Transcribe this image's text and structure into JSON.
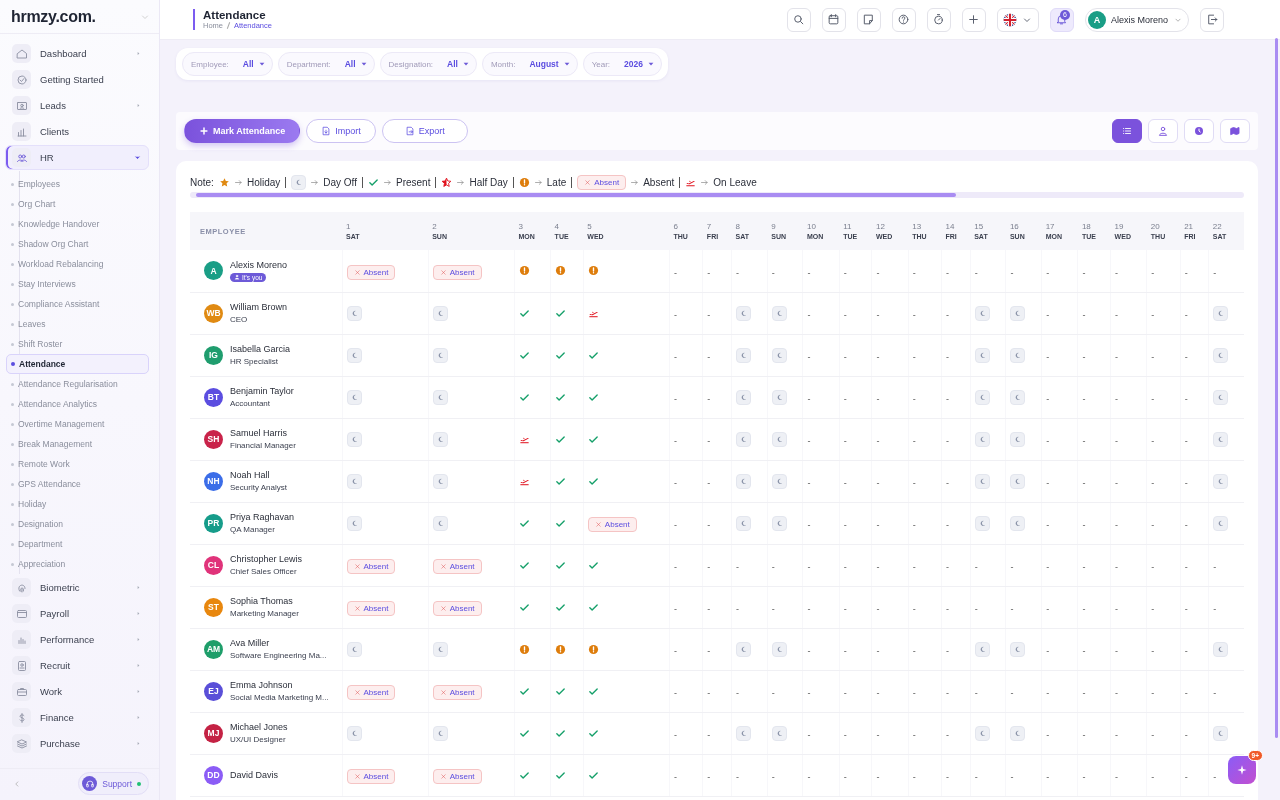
{
  "sidebar": {
    "logo": "hrmzy.com.",
    "items": [
      {
        "label": "Dashboard",
        "arrow": true,
        "selected": false
      },
      {
        "label": "Getting Started",
        "arrow": false,
        "selected": false
      },
      {
        "label": "Leads",
        "arrow": true,
        "selected": false
      },
      {
        "label": "Clients",
        "arrow": false,
        "selected": false
      },
      {
        "label": "HR",
        "arrow": true,
        "selected": true,
        "expanded": true,
        "children": [
          {
            "label": "Employees",
            "selected": false
          },
          {
            "label": "Org Chart",
            "selected": false
          },
          {
            "label": "Knowledge Handover",
            "selected": false
          },
          {
            "label": "Shadow Org Chart",
            "selected": false
          },
          {
            "label": "Workload Rebalancing",
            "selected": false
          },
          {
            "label": "Stay Interviews",
            "selected": false
          },
          {
            "label": "Compliance Assistant",
            "selected": false
          },
          {
            "label": "Leaves",
            "selected": false
          },
          {
            "label": "Shift Roster",
            "selected": false
          },
          {
            "label": "Attendance",
            "selected": true
          },
          {
            "label": "Attendance Regularisation",
            "selected": false
          },
          {
            "label": "Attendance Analytics",
            "selected": false
          },
          {
            "label": "Overtime Management",
            "selected": false
          },
          {
            "label": "Break Management",
            "selected": false
          },
          {
            "label": "Remote Work",
            "selected": false
          },
          {
            "label": "GPS Attendance",
            "selected": false
          },
          {
            "label": "Holiday",
            "selected": false
          },
          {
            "label": "Designation",
            "selected": false
          },
          {
            "label": "Department",
            "selected": false
          },
          {
            "label": "Appreciation",
            "selected": false
          }
        ]
      },
      {
        "label": "Biometric",
        "arrow": true,
        "selected": false
      },
      {
        "label": "Payroll",
        "arrow": true,
        "selected": false
      },
      {
        "label": "Performance",
        "arrow": true,
        "selected": false
      },
      {
        "label": "Recruit",
        "arrow": true,
        "selected": false
      },
      {
        "label": "Work",
        "arrow": true,
        "selected": false
      },
      {
        "label": "Finance",
        "arrow": true,
        "selected": false
      },
      {
        "label": "Purchase",
        "arrow": true,
        "selected": false
      }
    ],
    "support": "Support"
  },
  "header": {
    "title": "Attendance",
    "breadcrumb": [
      {
        "label": "Home",
        "selected": false
      },
      {
        "label": "Attendance",
        "selected": true
      }
    ],
    "notifications": "6",
    "user": {
      "initial": "A",
      "name": "Alexis Moreno"
    }
  },
  "filters": [
    {
      "label": "Employee:",
      "value": "All"
    },
    {
      "label": "Department:",
      "value": "All"
    },
    {
      "label": "Designation:",
      "value": "All"
    },
    {
      "label": "Month:",
      "value": "August"
    },
    {
      "label": "Year:",
      "value": "2026"
    }
  ],
  "actions": [
    {
      "kind": "mark",
      "label": "Mark Attendance"
    },
    {
      "kind": "import",
      "label": "Import"
    },
    {
      "kind": "export",
      "label": "Export"
    }
  ],
  "views": [
    {
      "kind": "list",
      "selected": true
    },
    {
      "kind": "person",
      "selected": false
    },
    {
      "kind": "clock",
      "selected": false
    },
    {
      "kind": "map",
      "selected": false
    }
  ],
  "legend": {
    "title": "Note:",
    "items": [
      {
        "kind": "holiday",
        "label": "Holiday"
      },
      {
        "kind": "dayoff",
        "label": "Day Off"
      },
      {
        "kind": "present",
        "label": "Present"
      },
      {
        "kind": "halfday",
        "label": "Half Day"
      },
      {
        "kind": "late",
        "label": "Late"
      },
      {
        "kind": "absent",
        "badge": "Absent",
        "label": "Absent"
      },
      {
        "kind": "leave",
        "label": "On Leave"
      }
    ]
  },
  "table": {
    "first_column": "EMPLOYEE",
    "days": [
      {
        "day": "1",
        "weekday": "SAT"
      },
      {
        "day": "2",
        "weekday": "SUN"
      },
      {
        "day": "3",
        "weekday": "MON"
      },
      {
        "day": "4",
        "weekday": "TUE"
      },
      {
        "day": "5",
        "weekday": "WED"
      },
      {
        "day": "6",
        "weekday": "THU"
      },
      {
        "day": "7",
        "weekday": "FRI"
      },
      {
        "day": "8",
        "weekday": "SAT"
      },
      {
        "day": "9",
        "weekday": "SUN"
      },
      {
        "day": "10",
        "weekday": "MON"
      },
      {
        "day": "11",
        "weekday": "TUE"
      },
      {
        "day": "12",
        "weekday": "WED"
      },
      {
        "day": "13",
        "weekday": "THU"
      },
      {
        "day": "14",
        "weekday": "FRI"
      },
      {
        "day": "15",
        "weekday": "SAT"
      },
      {
        "day": "16",
        "weekday": "SUN"
      },
      {
        "day": "17",
        "weekday": "MON"
      },
      {
        "day": "18",
        "weekday": "TUE"
      },
      {
        "day": "19",
        "weekday": "WED"
      },
      {
        "day": "20",
        "weekday": "THU"
      },
      {
        "day": "21",
        "weekday": "FRI"
      },
      {
        "day": "22",
        "weekday": "SAT"
      }
    ],
    "rows": [
      {
        "initials": "A",
        "color": "#1a9e86",
        "name": "Alexis Moreno",
        "you": "It's you",
        "cells": [
          {
            "kind": "absent",
            "text": "Absent"
          },
          {
            "kind": "absent",
            "text": "Absent"
          },
          {
            "kind": "late"
          },
          {
            "kind": "late"
          },
          {
            "kind": "late"
          },
          {
            "kind": "none",
            "text": "-"
          },
          {
            "kind": "none",
            "text": "-"
          },
          {
            "kind": "none",
            "text": "-"
          },
          {
            "kind": "none",
            "text": "-"
          },
          {
            "kind": "none",
            "text": "-"
          },
          {
            "kind": "none",
            "text": "-"
          },
          {
            "kind": "none",
            "text": "-"
          },
          {
            "kind": "none",
            "text": "-"
          },
          {
            "kind": "none",
            "text": "-"
          },
          {
            "kind": "none",
            "text": "-"
          },
          {
            "kind": "none",
            "text": "-"
          },
          {
            "kind": "none",
            "text": "-"
          },
          {
            "kind": "none",
            "text": "-"
          },
          {
            "kind": "none",
            "text": "-"
          },
          {
            "kind": "none",
            "text": "-"
          },
          {
            "kind": "none",
            "text": "-"
          },
          {
            "kind": "none",
            "text": "-"
          }
        ]
      },
      {
        "initials": "WB",
        "color": "#e08a12",
        "name": "William Brown",
        "role": "CEO",
        "cells": [
          {
            "kind": "dayoff"
          },
          {
            "kind": "dayoff"
          },
          {
            "kind": "present"
          },
          {
            "kind": "present"
          },
          {
            "kind": "leave"
          },
          {
            "kind": "none",
            "text": "-"
          },
          {
            "kind": "none",
            "text": "-"
          },
          {
            "kind": "dayoff"
          },
          {
            "kind": "dayoff"
          },
          {
            "kind": "none",
            "text": "-"
          },
          {
            "kind": "none",
            "text": "-"
          },
          {
            "kind": "none",
            "text": "-"
          },
          {
            "kind": "none",
            "text": "-"
          },
          {
            "kind": "none",
            "text": "-"
          },
          {
            "kind": "dayoff"
          },
          {
            "kind": "dayoff"
          },
          {
            "kind": "none",
            "text": "-"
          },
          {
            "kind": "none",
            "text": "-"
          },
          {
            "kind": "none",
            "text": "-"
          },
          {
            "kind": "none",
            "text": "-"
          },
          {
            "kind": "none",
            "text": "-"
          },
          {
            "kind": "dayoff"
          }
        ]
      },
      {
        "initials": "IG",
        "color": "#1f9d6e",
        "name": "Isabella Garcia",
        "role": "HR Specialist",
        "cells": [
          {
            "kind": "dayoff"
          },
          {
            "kind": "dayoff"
          },
          {
            "kind": "present"
          },
          {
            "kind": "present"
          },
          {
            "kind": "present"
          },
          {
            "kind": "none",
            "text": "-"
          },
          {
            "kind": "none",
            "text": "-"
          },
          {
            "kind": "dayoff"
          },
          {
            "kind": "dayoff"
          },
          {
            "kind": "none",
            "text": "-"
          },
          {
            "kind": "none",
            "text": "-"
          },
          {
            "kind": "none",
            "text": "-"
          },
          {
            "kind": "none",
            "text": "-"
          },
          {
            "kind": "none",
            "text": "-"
          },
          {
            "kind": "dayoff"
          },
          {
            "kind": "dayoff"
          },
          {
            "kind": "none",
            "text": "-"
          },
          {
            "kind": "none",
            "text": "-"
          },
          {
            "kind": "none",
            "text": "-"
          },
          {
            "kind": "none",
            "text": "-"
          },
          {
            "kind": "none",
            "text": "-"
          },
          {
            "kind": "dayoff"
          }
        ]
      },
      {
        "initials": "BT",
        "color": "#5b4de0",
        "name": "Benjamin Taylor",
        "role": "Accountant",
        "cells": [
          {
            "kind": "dayoff"
          },
          {
            "kind": "dayoff"
          },
          {
            "kind": "present"
          },
          {
            "kind": "present"
          },
          {
            "kind": "present"
          },
          {
            "kind": "none",
            "text": "-"
          },
          {
            "kind": "none",
            "text": "-"
          },
          {
            "kind": "dayoff"
          },
          {
            "kind": "dayoff"
          },
          {
            "kind": "none",
            "text": "-"
          },
          {
            "kind": "none",
            "text": "-"
          },
          {
            "kind": "none",
            "text": "-"
          },
          {
            "kind": "none",
            "text": "-"
          },
          {
            "kind": "none",
            "text": "-"
          },
          {
            "kind": "dayoff"
          },
          {
            "kind": "dayoff"
          },
          {
            "kind": "none",
            "text": "-"
          },
          {
            "kind": "none",
            "text": "-"
          },
          {
            "kind": "none",
            "text": "-"
          },
          {
            "kind": "none",
            "text": "-"
          },
          {
            "kind": "none",
            "text": "-"
          },
          {
            "kind": "dayoff"
          }
        ]
      },
      {
        "initials": "SH",
        "color": "#c9234a",
        "name": "Samuel Harris",
        "role": "Financial Manager",
        "cells": [
          {
            "kind": "dayoff"
          },
          {
            "kind": "dayoff"
          },
          {
            "kind": "leave"
          },
          {
            "kind": "present"
          },
          {
            "kind": "present"
          },
          {
            "kind": "none",
            "text": "-"
          },
          {
            "kind": "none",
            "text": "-"
          },
          {
            "kind": "dayoff"
          },
          {
            "kind": "dayoff"
          },
          {
            "kind": "none",
            "text": "-"
          },
          {
            "kind": "none",
            "text": "-"
          },
          {
            "kind": "none",
            "text": "-"
          },
          {
            "kind": "none",
            "text": "-"
          },
          {
            "kind": "none",
            "text": "-"
          },
          {
            "kind": "dayoff"
          },
          {
            "kind": "dayoff"
          },
          {
            "kind": "none",
            "text": "-"
          },
          {
            "kind": "none",
            "text": "-"
          },
          {
            "kind": "none",
            "text": "-"
          },
          {
            "kind": "none",
            "text": "-"
          },
          {
            "kind": "none",
            "text": "-"
          },
          {
            "kind": "dayoff"
          }
        ]
      },
      {
        "initials": "NH",
        "color": "#3b6de8",
        "name": "Noah Hall",
        "role": "Security Analyst",
        "cells": [
          {
            "kind": "dayoff"
          },
          {
            "kind": "dayoff"
          },
          {
            "kind": "leave"
          },
          {
            "kind": "present"
          },
          {
            "kind": "present"
          },
          {
            "kind": "none",
            "text": "-"
          },
          {
            "kind": "none",
            "text": "-"
          },
          {
            "kind": "dayoff"
          },
          {
            "kind": "dayoff"
          },
          {
            "kind": "none",
            "text": "-"
          },
          {
            "kind": "none",
            "text": "-"
          },
          {
            "kind": "none",
            "text": "-"
          },
          {
            "kind": "none",
            "text": "-"
          },
          {
            "kind": "none",
            "text": "-"
          },
          {
            "kind": "dayoff"
          },
          {
            "kind": "dayoff"
          },
          {
            "kind": "none",
            "text": "-"
          },
          {
            "kind": "none",
            "text": "-"
          },
          {
            "kind": "none",
            "text": "-"
          },
          {
            "kind": "none",
            "text": "-"
          },
          {
            "kind": "none",
            "text": "-"
          },
          {
            "kind": "dayoff"
          }
        ]
      },
      {
        "initials": "PR",
        "color": "#169c8a",
        "name": "Priya Raghavan",
        "role": "QA Manager",
        "cells": [
          {
            "kind": "dayoff"
          },
          {
            "kind": "dayoff"
          },
          {
            "kind": "present"
          },
          {
            "kind": "present"
          },
          {
            "kind": "absent",
            "text": "Absent"
          },
          {
            "kind": "none",
            "text": "-"
          },
          {
            "kind": "none",
            "text": "-"
          },
          {
            "kind": "dayoff"
          },
          {
            "kind": "dayoff"
          },
          {
            "kind": "none",
            "text": "-"
          },
          {
            "kind": "none",
            "text": "-"
          },
          {
            "kind": "none",
            "text": "-"
          },
          {
            "kind": "none",
            "text": "-"
          },
          {
            "kind": "none",
            "text": "-"
          },
          {
            "kind": "dayoff"
          },
          {
            "kind": "dayoff"
          },
          {
            "kind": "none",
            "text": "-"
          },
          {
            "kind": "none",
            "text": "-"
          },
          {
            "kind": "none",
            "text": "-"
          },
          {
            "kind": "none",
            "text": "-"
          },
          {
            "kind": "none",
            "text": "-"
          },
          {
            "kind": "dayoff"
          }
        ]
      },
      {
        "initials": "CL",
        "color": "#e0337a",
        "name": "Christopher Lewis",
        "role": "Chief Sales Officer",
        "cells": [
          {
            "kind": "absent",
            "text": "Absent"
          },
          {
            "kind": "absent",
            "text": "Absent"
          },
          {
            "kind": "present"
          },
          {
            "kind": "present"
          },
          {
            "kind": "present"
          },
          {
            "kind": "none",
            "text": "-"
          },
          {
            "kind": "none",
            "text": "-"
          },
          {
            "kind": "none",
            "text": "-"
          },
          {
            "kind": "none",
            "text": "-"
          },
          {
            "kind": "none",
            "text": "-"
          },
          {
            "kind": "none",
            "text": "-"
          },
          {
            "kind": "none",
            "text": "-"
          },
          {
            "kind": "none",
            "text": "-"
          },
          {
            "kind": "none",
            "text": "-"
          },
          {
            "kind": "none",
            "text": "-"
          },
          {
            "kind": "none",
            "text": "-"
          },
          {
            "kind": "none",
            "text": "-"
          },
          {
            "kind": "none",
            "text": "-"
          },
          {
            "kind": "none",
            "text": "-"
          },
          {
            "kind": "none",
            "text": "-"
          },
          {
            "kind": "none",
            "text": "-"
          },
          {
            "kind": "none",
            "text": "-"
          }
        ]
      },
      {
        "initials": "ST",
        "color": "#e8870e",
        "name": "Sophia Thomas",
        "role": "Marketing Manager",
        "cells": [
          {
            "kind": "absent",
            "text": "Absent"
          },
          {
            "kind": "absent",
            "text": "Absent"
          },
          {
            "kind": "present"
          },
          {
            "kind": "present"
          },
          {
            "kind": "present"
          },
          {
            "kind": "none",
            "text": "-"
          },
          {
            "kind": "none",
            "text": "-"
          },
          {
            "kind": "none",
            "text": "-"
          },
          {
            "kind": "none",
            "text": "-"
          },
          {
            "kind": "none",
            "text": "-"
          },
          {
            "kind": "none",
            "text": "-"
          },
          {
            "kind": "none",
            "text": "-"
          },
          {
            "kind": "none",
            "text": "-"
          },
          {
            "kind": "none",
            "text": "-"
          },
          {
            "kind": "none",
            "text": "-"
          },
          {
            "kind": "none",
            "text": "-"
          },
          {
            "kind": "none",
            "text": "-"
          },
          {
            "kind": "none",
            "text": "-"
          },
          {
            "kind": "none",
            "text": "-"
          },
          {
            "kind": "none",
            "text": "-"
          },
          {
            "kind": "none",
            "text": "-"
          },
          {
            "kind": "none",
            "text": "-"
          }
        ]
      },
      {
        "initials": "AM",
        "color": "#1e9e6a",
        "name": "Ava Miller",
        "role": "Software Engineering Ma...",
        "cells": [
          {
            "kind": "dayoff"
          },
          {
            "kind": "dayoff"
          },
          {
            "kind": "late"
          },
          {
            "kind": "late"
          },
          {
            "kind": "late"
          },
          {
            "kind": "none",
            "text": "-"
          },
          {
            "kind": "none",
            "text": "-"
          },
          {
            "kind": "dayoff"
          },
          {
            "kind": "dayoff"
          },
          {
            "kind": "none",
            "text": "-"
          },
          {
            "kind": "none",
            "text": "-"
          },
          {
            "kind": "none",
            "text": "-"
          },
          {
            "kind": "none",
            "text": "-"
          },
          {
            "kind": "none",
            "text": "-"
          },
          {
            "kind": "dayoff"
          },
          {
            "kind": "dayoff"
          },
          {
            "kind": "none",
            "text": "-"
          },
          {
            "kind": "none",
            "text": "-"
          },
          {
            "kind": "none",
            "text": "-"
          },
          {
            "kind": "none",
            "text": "-"
          },
          {
            "kind": "none",
            "text": "-"
          },
          {
            "kind": "dayoff"
          }
        ]
      },
      {
        "initials": "EJ",
        "color": "#5a4fd8",
        "name": "Emma Johnson",
        "role": "Social Media Marketing M...",
        "cells": [
          {
            "kind": "absent",
            "text": "Absent"
          },
          {
            "kind": "absent",
            "text": "Absent"
          },
          {
            "kind": "present"
          },
          {
            "kind": "present"
          },
          {
            "kind": "present"
          },
          {
            "kind": "none",
            "text": "-"
          },
          {
            "kind": "none",
            "text": "-"
          },
          {
            "kind": "none",
            "text": "-"
          },
          {
            "kind": "none",
            "text": "-"
          },
          {
            "kind": "none",
            "text": "-"
          },
          {
            "kind": "none",
            "text": "-"
          },
          {
            "kind": "none",
            "text": "-"
          },
          {
            "kind": "none",
            "text": "-"
          },
          {
            "kind": "none",
            "text": "-"
          },
          {
            "kind": "none",
            "text": "-"
          },
          {
            "kind": "none",
            "text": "-"
          },
          {
            "kind": "none",
            "text": "-"
          },
          {
            "kind": "none",
            "text": "-"
          },
          {
            "kind": "none",
            "text": "-"
          },
          {
            "kind": "none",
            "text": "-"
          },
          {
            "kind": "none",
            "text": "-"
          },
          {
            "kind": "none",
            "text": "-"
          }
        ]
      },
      {
        "initials": "MJ",
        "color": "#c42244",
        "name": "Michael Jones",
        "role": "UX/UI Designer",
        "cells": [
          {
            "kind": "dayoff"
          },
          {
            "kind": "dayoff"
          },
          {
            "kind": "present"
          },
          {
            "kind": "present"
          },
          {
            "kind": "present"
          },
          {
            "kind": "none",
            "text": "-"
          },
          {
            "kind": "none",
            "text": "-"
          },
          {
            "kind": "dayoff"
          },
          {
            "kind": "dayoff"
          },
          {
            "kind": "none",
            "text": "-"
          },
          {
            "kind": "none",
            "text": "-"
          },
          {
            "kind": "none",
            "text": "-"
          },
          {
            "kind": "none",
            "text": "-"
          },
          {
            "kind": "none",
            "text": "-"
          },
          {
            "kind": "dayoff"
          },
          {
            "kind": "dayoff"
          },
          {
            "kind": "none",
            "text": "-"
          },
          {
            "kind": "none",
            "text": "-"
          },
          {
            "kind": "none",
            "text": "-"
          },
          {
            "kind": "none",
            "text": "-"
          },
          {
            "kind": "none",
            "text": "-"
          },
          {
            "kind": "dayoff"
          }
        ]
      },
      {
        "initials": "DD",
        "color": "#8b5cf6",
        "name": "David Davis",
        "cells": [
          {
            "kind": "absent",
            "text": "Absent"
          },
          {
            "kind": "absent",
            "text": "Absent"
          },
          {
            "kind": "present"
          },
          {
            "kind": "present"
          },
          {
            "kind": "present"
          },
          {
            "kind": "none",
            "text": "-"
          },
          {
            "kind": "none",
            "text": "-"
          },
          {
            "kind": "none",
            "text": "-"
          },
          {
            "kind": "none",
            "text": "-"
          },
          {
            "kind": "none",
            "text": "-"
          },
          {
            "kind": "none",
            "text": "-"
          },
          {
            "kind": "none",
            "text": "-"
          },
          {
            "kind": "none",
            "text": "-"
          },
          {
            "kind": "none",
            "text": "-"
          },
          {
            "kind": "none",
            "text": "-"
          },
          {
            "kind": "none",
            "text": "-"
          },
          {
            "kind": "none",
            "text": "-"
          },
          {
            "kind": "none",
            "text": "-"
          },
          {
            "kind": "none",
            "text": "-"
          },
          {
            "kind": "none",
            "text": "-"
          },
          {
            "kind": "none",
            "text": "-"
          },
          {
            "kind": "none",
            "text": "-"
          }
        ]
      }
    ]
  },
  "assistant_badge": "9+"
}
